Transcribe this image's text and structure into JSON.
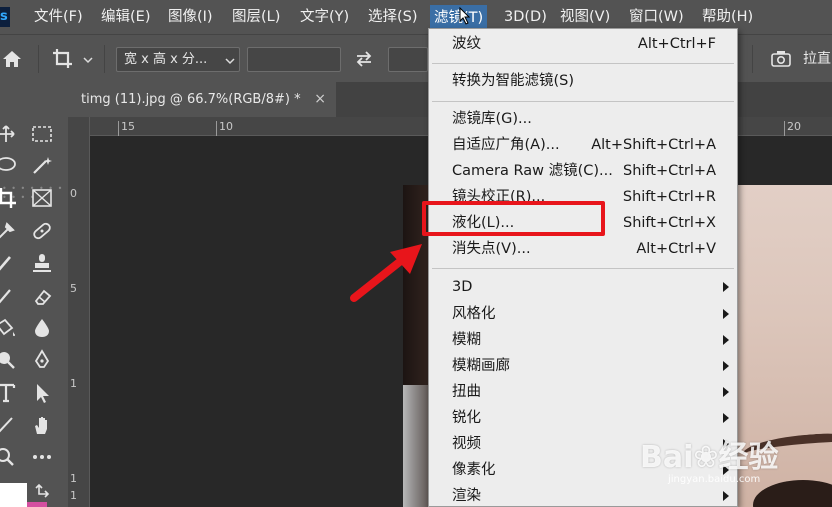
{
  "app": {
    "logo_text": "s",
    "colors": {
      "menubar": "#535353",
      "menu_active": "#3a6ea5",
      "dropdown_bg": "#ededed",
      "annotation_red": "#e8151b"
    }
  },
  "menubar": {
    "items": [
      {
        "label": "文件(F)"
      },
      {
        "label": "编辑(E)"
      },
      {
        "label": "图像(I)"
      },
      {
        "label": "图层(L)"
      },
      {
        "label": "文字(Y)"
      },
      {
        "label": "选择(S)"
      },
      {
        "label": "滤镜(T)",
        "active": true
      },
      {
        "label": "3D(D)"
      },
      {
        "label": "视图(V)"
      },
      {
        "label": "窗口(W)"
      },
      {
        "label": "帮助(H)"
      }
    ]
  },
  "options_bar": {
    "home_icon": "home-icon",
    "crop_icon": "crop-icon",
    "ratio_select": "宽 x 高 x 分...",
    "swap_icon": "swap-icon",
    "straighten_label": "拉直"
  },
  "document": {
    "tab_title": "timg (11).jpg @ 66.7%(RGB/8#) *",
    "close_symbol": "×"
  },
  "rulers": {
    "top_labels": [
      "15",
      "10",
      "20"
    ],
    "left_labels": [
      "0",
      "5",
      "1",
      "1",
      "1"
    ]
  },
  "filter_menu": {
    "items": [
      {
        "label": "波纹",
        "shortcut": "Alt+Ctrl+F"
      },
      {
        "label": "转换为智能滤镜(S)",
        "shortcut": ""
      },
      {
        "label": "滤镜库(G)...",
        "shortcut": ""
      },
      {
        "label": "自适应广角(A)...",
        "shortcut": "Alt+Shift+Ctrl+A"
      },
      {
        "label": "Camera Raw 滤镜(C)...",
        "shortcut": "Shift+Ctrl+A"
      },
      {
        "label": "镜头校正(R)...",
        "shortcut": "Shift+Ctrl+R"
      },
      {
        "label": "液化(L)...",
        "shortcut": "Shift+Ctrl+X",
        "highlighted": true
      },
      {
        "label": "消失点(V)...",
        "shortcut": "Alt+Ctrl+V"
      },
      {
        "label": "3D",
        "submenu": true
      },
      {
        "label": "风格化",
        "submenu": true
      },
      {
        "label": "模糊",
        "submenu": true
      },
      {
        "label": "模糊画廊",
        "submenu": true
      },
      {
        "label": "扭曲",
        "submenu": true
      },
      {
        "label": "锐化",
        "submenu": true
      },
      {
        "label": "视频",
        "submenu": true
      },
      {
        "label": "像素化",
        "submenu": true
      },
      {
        "label": "渲染",
        "submenu": true
      }
    ]
  },
  "watermark": {
    "main": "Bai❀经验",
    "sub": "jingyan.baidu.com"
  }
}
